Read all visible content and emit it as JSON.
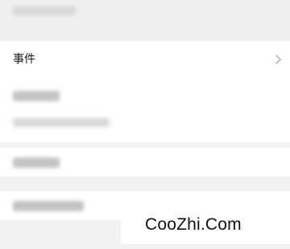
{
  "event_row": {
    "label": "事件"
  },
  "watermark": {
    "text": "CooZhi.Com"
  },
  "icons": {
    "chevron": "chevron-right-icon"
  },
  "colors": {
    "background": "#f2f2f2",
    "row": "#ffffff",
    "chevron": "#b5b5b5"
  }
}
